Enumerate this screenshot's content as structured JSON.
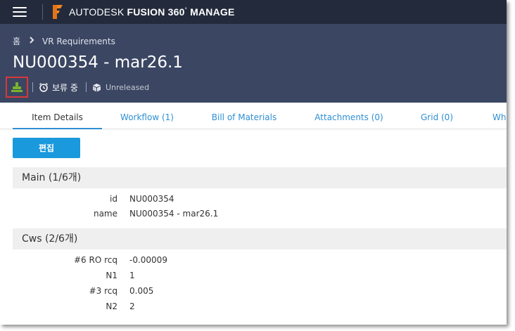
{
  "app": {
    "brand_prefix": "AUTODESK",
    "brand_name": "FUSION 360",
    "brand_mark": "°",
    "brand_suffix": "MANAGE"
  },
  "breadcrumb": {
    "home": "홈",
    "workspace": "VR Requirements"
  },
  "item": {
    "title": "NU000354 - mar26.1",
    "status": "보류 중",
    "lifecycle": "Unreleased"
  },
  "tabs": [
    {
      "label": "Item Details",
      "active": true
    },
    {
      "label": "Workflow (1)"
    },
    {
      "label": "Bill of Materials"
    },
    {
      "label": "Attachments (0)"
    },
    {
      "label": "Grid (0)"
    },
    {
      "label": "Wh"
    }
  ],
  "actions": {
    "edit_label": "편집"
  },
  "sections": [
    {
      "title": "Main (1/6개)",
      "fields": [
        {
          "label": "id",
          "value": "NU000354"
        },
        {
          "label": "name",
          "value": "NU000354 - mar26.1"
        }
      ]
    },
    {
      "title": "Cws (2/6개)",
      "fields": [
        {
          "label": "#6 RO rcq",
          "value": "-0.00009"
        },
        {
          "label": "N1",
          "value": "1"
        },
        {
          "label": "#3 rcq",
          "value": "0.005"
        },
        {
          "label": "N2",
          "value": "2"
        }
      ]
    }
  ],
  "colors": {
    "topbar": "#232a3b",
    "header": "#3b4662",
    "accent": "#1a99dc",
    "tab_link": "#2e8fd2",
    "logo": "#f6871f",
    "stamp": "#7ab52b",
    "highlight": "#d9383a"
  },
  "icons": {
    "menu": "hamburger-menu-icon",
    "logo": "fusion-logo-icon",
    "chevron": "chevron-right-icon",
    "stamp": "stamp-icon",
    "status": "alarm-clock-icon",
    "lifecycle": "cube-icon"
  }
}
